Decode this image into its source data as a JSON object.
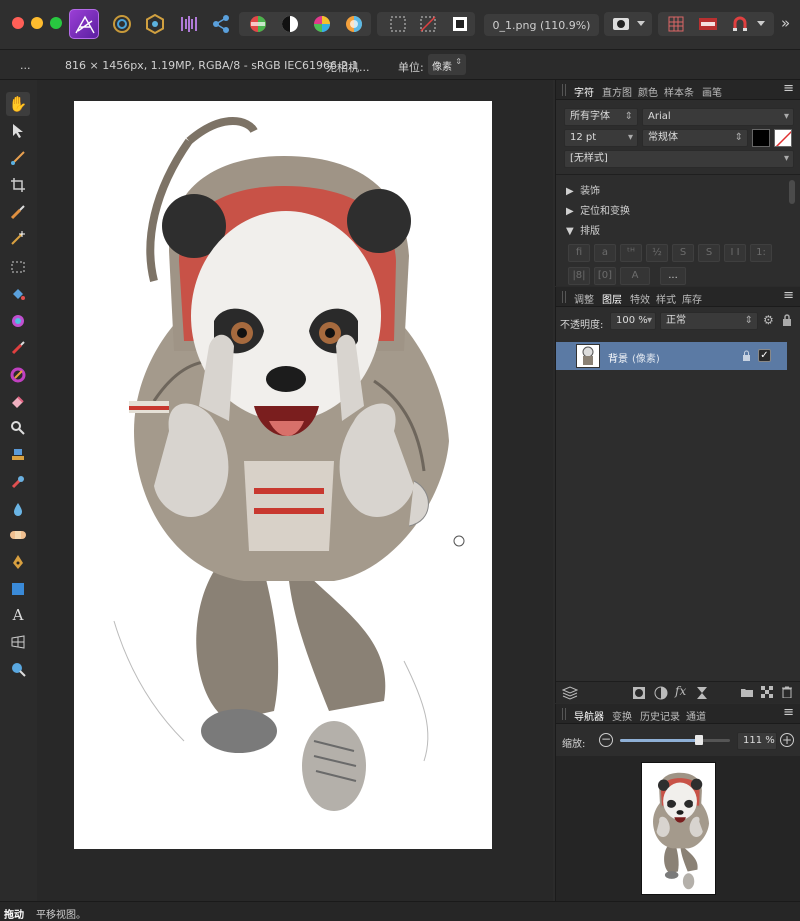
{
  "toolbar": {
    "file_label": "0_1.png (110.9%)",
    "more_label": "»"
  },
  "context": {
    "ellipsis": "...",
    "doc_info": "816 × 1456px, 1.19MP, RGBA/8 - sRGB IEC61966-2.1",
    "camera": "无相机...",
    "unit_label": "单位:",
    "unit_value": "像素"
  },
  "character_panel": {
    "tabs": [
      "字符",
      "直方图",
      "颜色",
      "样本条",
      "画笔"
    ],
    "font_collection": "所有字体",
    "font_family": "Arial",
    "font_size": "12 pt",
    "font_style": "常规体",
    "text_style": "[无样式]",
    "sections": [
      "装饰",
      "定位和变换",
      "排版"
    ],
    "typography_glyphs": [
      "fi",
      "a",
      "ᵗᴴ",
      "½",
      "S",
      "S",
      "I I",
      "1:",
      "|8|",
      "[0]",
      "A",
      "..."
    ]
  },
  "layers_panel": {
    "tabs": [
      "调整",
      "图层",
      "特效",
      "样式",
      "库存"
    ],
    "opacity_label": "不透明度:",
    "opacity_value": "100 %",
    "blend_mode": "正常",
    "layer_name": "背景",
    "layer_type": "(像素)"
  },
  "navigator_panel": {
    "tabs": [
      "导航器",
      "变换",
      "历史记录",
      "通道"
    ],
    "zoom_label": "缩放:",
    "zoom_value": "111 %",
    "zoom_slider": 0.72
  },
  "status": {
    "tool": "拖动",
    "hint": "平移视图。"
  },
  "colors": {
    "accent": "#5b7aa4",
    "app_purple": "#8a35c9"
  }
}
